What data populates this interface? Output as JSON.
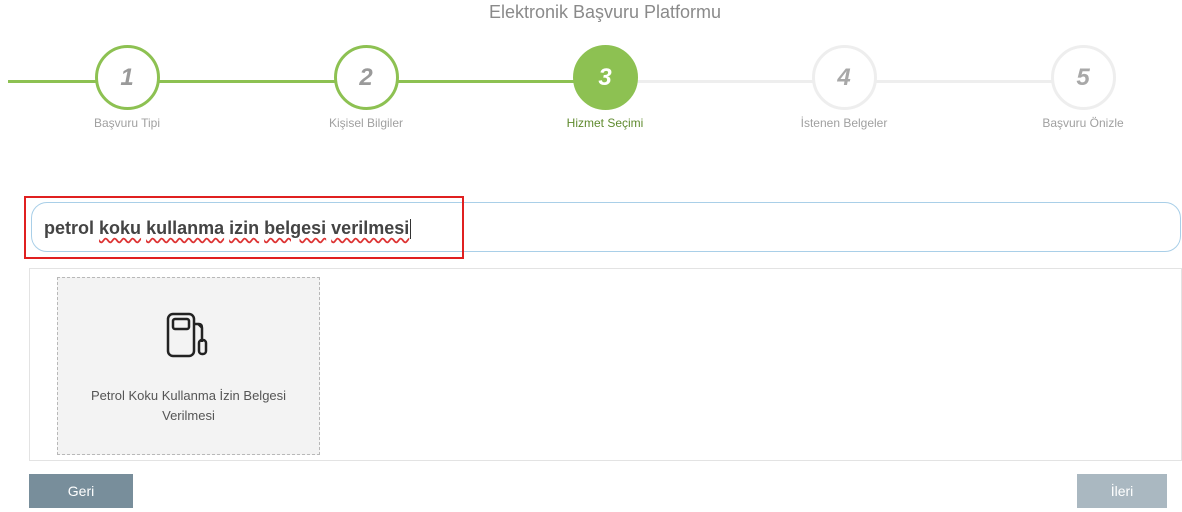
{
  "header": {
    "title": "Elektronik Başvuru Platformu"
  },
  "steps": [
    {
      "number": "1",
      "label": "Başvuru Tipi",
      "state": "completed"
    },
    {
      "number": "2",
      "label": "Kişisel Bilgiler",
      "state": "completed"
    },
    {
      "number": "3",
      "label": "Hizmet Seçimi",
      "state": "active"
    },
    {
      "number": "4",
      "label": "İstenen Belgeler",
      "state": "pending"
    },
    {
      "number": "5",
      "label": "Başvuru Önizle",
      "state": "pending"
    }
  ],
  "search": {
    "words": [
      "petrol",
      "koku",
      "kullanma",
      "izin",
      "belgesi",
      "verilmesi"
    ],
    "value": "petrol koku kullanma izin belgesi verilmesi"
  },
  "results": [
    {
      "icon": "fuel-pump-icon",
      "label": "Petrol Koku Kullanma İzin Belgesi Verilmesi"
    }
  ],
  "nav": {
    "back_label": "Geri",
    "next_label": "İleri"
  },
  "colors": {
    "accent": "#8dc152",
    "highlight": "#e02020",
    "back_button": "#788e9b",
    "next_button": "#aab8c1"
  }
}
